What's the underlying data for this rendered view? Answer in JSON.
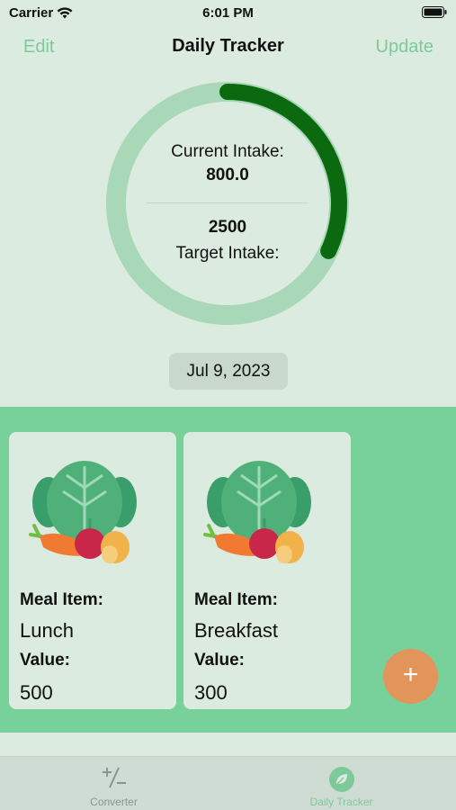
{
  "status_bar": {
    "carrier": "Carrier",
    "time": "6:01 PM"
  },
  "nav": {
    "edit": "Edit",
    "title": "Daily Tracker",
    "update": "Update"
  },
  "progress": {
    "current_label": "Current Intake:",
    "current_value": "800.0",
    "target_value": "2500",
    "target_label": "Target Intake:",
    "fraction": 0.32
  },
  "date": "Jul 9, 2023",
  "meals": [
    {
      "item_label": "Meal Item:",
      "item": "Lunch",
      "value_label": "Value:",
      "value": "500"
    },
    {
      "item_label": "Meal Item:",
      "item": "Breakfast",
      "value_label": "Value:",
      "value": "300"
    }
  ],
  "fab": {
    "icon": "plus-icon",
    "label": "+"
  },
  "tabs": [
    {
      "label": "Converter",
      "icon": "plus-minus-icon"
    },
    {
      "label": "Daily Tracker",
      "icon": "leaf-icon"
    }
  ],
  "colors": {
    "background": "#dcebdf",
    "accent": "#7ec99a",
    "ring_track": "#a8d8b7",
    "ring_progress": "#0b6a10",
    "panel": "#78d09a",
    "fab": "#e2955a"
  }
}
